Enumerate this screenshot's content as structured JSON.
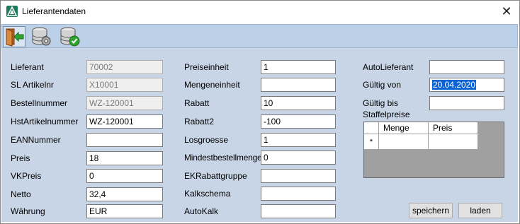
{
  "window": {
    "title": "Lieferantendaten"
  },
  "toolbar": {
    "buttons": [
      "exit-door-icon",
      "database-settings-icon",
      "database-check-icon"
    ]
  },
  "col1": {
    "lieferant": {
      "label": "Lieferant",
      "value": "70002"
    },
    "sl_artikelnr": {
      "label": "SL Artikelnr",
      "value": "X10001"
    },
    "bestellnummer": {
      "label": "Bestellnummer",
      "value": "WZ-120001"
    },
    "hst_artikelnummer": {
      "label": "HstArtikelnummer",
      "value": "WZ-120001"
    },
    "ean_nummer": {
      "label": "EANNummer",
      "value": ""
    },
    "preis": {
      "label": "Preis",
      "value": "18"
    },
    "vk_preis": {
      "label": "VKPreis",
      "value": "0"
    },
    "netto": {
      "label": "Netto",
      "value": "32,4"
    },
    "waehrung": {
      "label": "Währung",
      "value": "EUR"
    }
  },
  "col2": {
    "preiseinheit": {
      "label": "Preiseinheit",
      "value": "1"
    },
    "mengeneinheit": {
      "label": "Mengeneinheit",
      "value": ""
    },
    "rabatt": {
      "label": "Rabatt",
      "value": "10"
    },
    "rabatt2": {
      "label": "Rabatt2",
      "value": "-100"
    },
    "losgroesse": {
      "label": "Losgroesse",
      "value": "1"
    },
    "mindestbestellmenge": {
      "label": "Mindestbestellmenge",
      "value": "0"
    },
    "ek_rabattgruppe": {
      "label": "EKRabattgruppe",
      "value": ""
    },
    "kalkschema": {
      "label": "Kalkschema",
      "value": ""
    },
    "autokalk": {
      "label": "AutoKalk",
      "value": ""
    }
  },
  "col3": {
    "autolieferant": {
      "label": "AutoLieferant",
      "value": ""
    },
    "gueltig_von": {
      "label": "Gültig von",
      "value": "20.04.2020"
    },
    "gueltig_bis": {
      "label": "Gültig bis",
      "value": ""
    },
    "staffelpreise": {
      "label": "Staffelpreise"
    }
  },
  "grid": {
    "columns": [
      "Menge",
      "Preis"
    ],
    "new_row_marker": "*"
  },
  "buttons": {
    "save": "speichern",
    "load": "laden"
  },
  "colors": {
    "accent": "#0a64d6",
    "panel": "#c7d5e6",
    "toolbar": "#bcd0e8"
  }
}
